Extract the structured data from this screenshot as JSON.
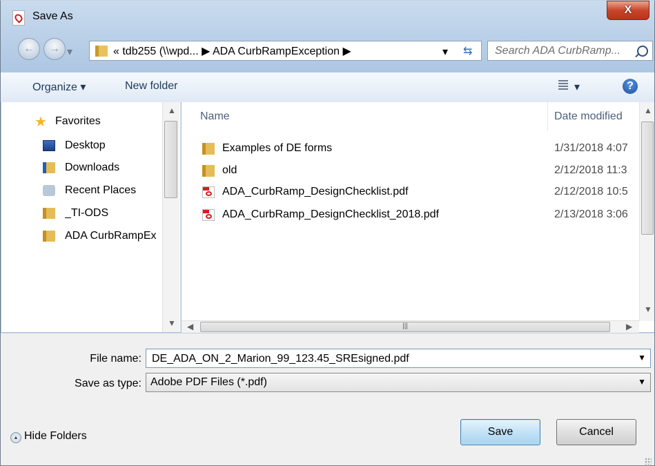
{
  "window": {
    "title": "Save As",
    "close_label": "X"
  },
  "address_bar": {
    "path": "« tdb255 (\\\\wpd... ▶ ADA CurbRampException ▶",
    "search_placeholder": "Search ADA CurbRamp..."
  },
  "toolbar": {
    "organize_label": "Organize ▾",
    "new_folder_label": "New folder"
  },
  "nav_pane": {
    "items": [
      {
        "label": "Favorites",
        "icon": "star-icon"
      },
      {
        "label": "Desktop",
        "icon": "desktop-icon"
      },
      {
        "label": "Downloads",
        "icon": "downloads-icon"
      },
      {
        "label": "Recent Places",
        "icon": "recent-places-icon"
      },
      {
        "label": "_TI-ODS",
        "icon": "folder-icon"
      },
      {
        "label": "ADA CurbRampEx",
        "icon": "folder-icon"
      }
    ]
  },
  "file_list": {
    "columns": {
      "name": "Name",
      "date": "Date modified"
    },
    "rows": [
      {
        "name": "Examples of DE forms",
        "date": "1/31/2018 4:07",
        "icon": "folder-icon"
      },
      {
        "name": "old",
        "date": "2/12/2018 11:3",
        "icon": "folder-icon"
      },
      {
        "name": "ADA_CurbRamp_DesignChecklist.pdf",
        "date": "2/12/2018 10:5",
        "icon": "pdf-icon"
      },
      {
        "name": "ADA_CurbRamp_DesignChecklist_2018.pdf",
        "date": "2/13/2018 3:06",
        "icon": "pdf-icon"
      }
    ]
  },
  "form": {
    "file_name_label": "File name:",
    "file_name_value": "DE_ADA_ON_2_Marion_99_123.45_SREsigned.pdf",
    "save_type_label": "Save as type:",
    "save_type_value": "Adobe PDF Files (*.pdf)"
  },
  "footer": {
    "hide_folders_label": "Hide Folders",
    "save_label": "Save",
    "cancel_label": "Cancel"
  },
  "colors": {
    "title_bar": "#b9cfe7",
    "close_button": "#c9462b",
    "save_button": "#c3e2f6"
  }
}
